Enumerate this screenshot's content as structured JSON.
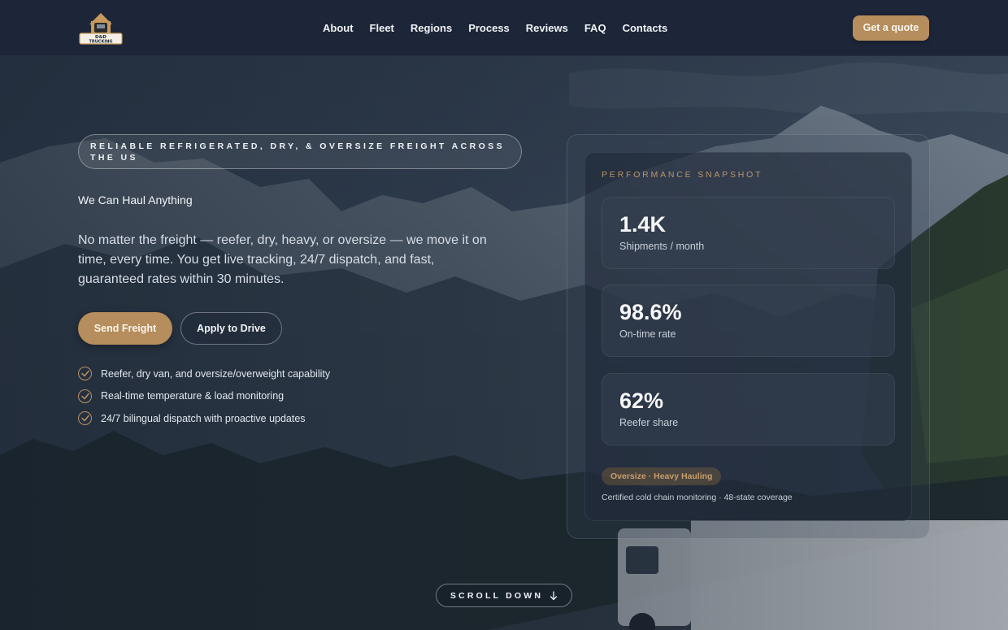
{
  "header": {
    "logo_text_line1": "D&D",
    "logo_text_line2": "TRUCKING",
    "nav": [
      "About",
      "Fleet",
      "Regions",
      "Process",
      "Reviews",
      "FAQ",
      "Contacts"
    ],
    "cta_label": "Get a quote"
  },
  "hero": {
    "tagline": "Reliable refrigerated, dry, & oversize freight across the US",
    "subhead": "We Can Haul Anything",
    "lead": "No matter the freight — reefer, dry, heavy, or oversize — we move it on time, every time. You get live tracking, 24/7 dispatch, and fast, guaranteed rates within 30 minutes.",
    "primary_button": "Send Freight",
    "secondary_button": "Apply to Drive",
    "features": [
      "Reefer, dry van, and oversize/overweight capability",
      "Real-time temperature & load monitoring",
      "24/7 bilingual dispatch with proactive updates"
    ]
  },
  "snapshot": {
    "label": "Performance snapshot",
    "stats": [
      {
        "value": "1.4K",
        "caption": "Shipments / month"
      },
      {
        "value": "98.6%",
        "caption": "On-time rate"
      },
      {
        "value": "62%",
        "caption": "Reefer share"
      }
    ],
    "badge": "Oversize · Heavy Hauling",
    "footnote": "Certified cold chain monitoring · 48-state coverage"
  },
  "scroll": {
    "label": "SCROLL DOWN",
    "icon": "arrow-down-icon"
  },
  "colors": {
    "accent": "#b68d5c",
    "header_bg": "#1c2638",
    "accent_text": "#b8956b"
  }
}
